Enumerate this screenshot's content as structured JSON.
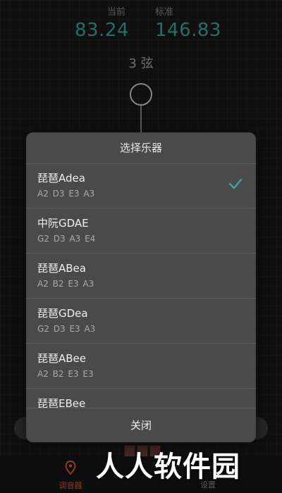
{
  "tuner": {
    "current_label": "当前",
    "standard_label": "标准",
    "current_value": "83.24",
    "standard_value": "146.83",
    "string_label": "3 弦"
  },
  "nav": {
    "tuner_label": "调音器",
    "settings_label": "设置"
  },
  "watermark": "人人软件园",
  "dialog": {
    "title": "选择乐器",
    "close_label": "关闭",
    "selected_index": 0,
    "items": [
      {
        "name": "琵琶Adea",
        "notes": "A2  D3 E3  A3"
      },
      {
        "name": "中阮GDAE",
        "notes": "G2  D3 A3  E4"
      },
      {
        "name": "琵琶ABea",
        "notes": "A2  B2 E3  A3"
      },
      {
        "name": "琵琶GDea",
        "notes": "G2 D3 E3  A3"
      },
      {
        "name": "琵琶ABee",
        "notes": "A2  B2 E3  E3"
      },
      {
        "name": "琵琶EBee",
        "notes": ""
      }
    ]
  },
  "colors": {
    "accent": "#3aa89c",
    "nav_active": "#e05a3a"
  }
}
